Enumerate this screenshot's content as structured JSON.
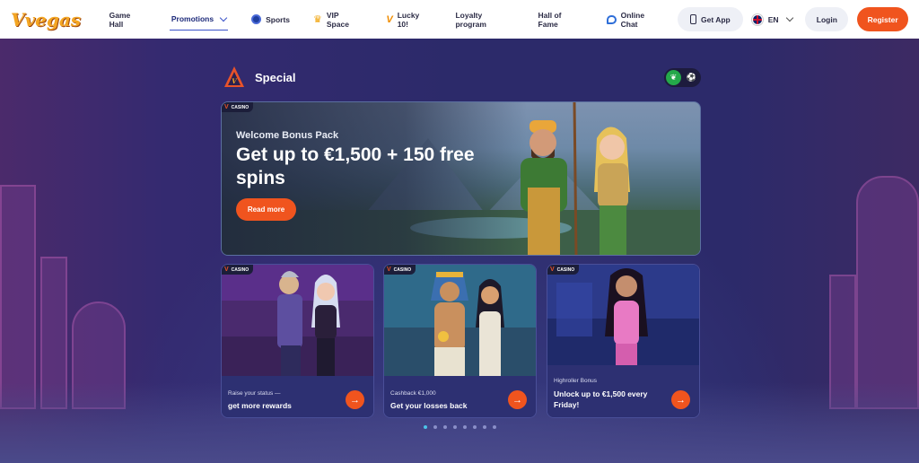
{
  "header": {
    "logo": "Vvegas",
    "nav": [
      {
        "label": "Game Hall",
        "icon": ""
      },
      {
        "label": "Promotions",
        "icon": "chevron-down-icon"
      },
      {
        "label": "Sports",
        "icon": "soccer-ball-icon"
      },
      {
        "label": "VIP Space",
        "icon": "crown-icon"
      },
      {
        "label": "Lucky 10!",
        "icon": "v-logo-icon"
      },
      {
        "label": "Loyalty program",
        "icon": ""
      },
      {
        "label": "Hall of Fame",
        "icon": ""
      }
    ],
    "online_chat": "Online Chat",
    "get_app": "Get App",
    "language": "EN",
    "login": "Login",
    "register": "Register"
  },
  "section": {
    "title": "Special",
    "filters": [
      {
        "icon": "cherries-icon",
        "active": true
      },
      {
        "icon": "soccer-ball-icon",
        "active": false
      }
    ]
  },
  "hero": {
    "tag": "CASINO",
    "subtitle": "Welcome Bonus Pack",
    "title": "Get up to €1,500 + 150 free spins",
    "cta": "Read more"
  },
  "cards": [
    {
      "tag": "CASINO",
      "subtitle": "Raise your status —",
      "title": "get more rewards"
    },
    {
      "tag": "CASINO",
      "subtitle": "Cashback €1,000",
      "title": "Get your losses back"
    },
    {
      "tag": "CASINO",
      "subtitle": "Highroller Bonus",
      "title": "Unlock up to €1,500 every Friday!"
    }
  ],
  "pagination": {
    "count": 8,
    "active": 0
  },
  "colors": {
    "accent": "#f0541e",
    "brand": "#f4a623",
    "active_dot": "#4cc3e8"
  }
}
